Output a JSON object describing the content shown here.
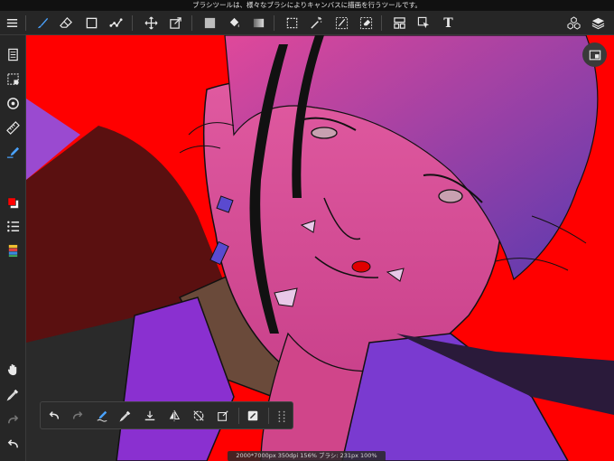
{
  "hint": {
    "text": "ブラシツールは、様々なブラシによりキャンバスに描画を行うツールです。"
  },
  "toolbar": {
    "text_tool_glyph": "T",
    "tools": [
      {
        "name": "menu-icon"
      },
      {
        "name": "brush-tool-icon",
        "active": true
      },
      {
        "name": "eraser-tool-icon"
      },
      {
        "name": "shape-tool-icon"
      },
      {
        "name": "dot-brush-icon"
      },
      {
        "name": "move-tool-icon"
      },
      {
        "name": "transform-tool-icon"
      },
      {
        "name": "fill-color-icon"
      },
      {
        "name": "bucket-tool-icon"
      },
      {
        "name": "gradient-tool-icon"
      },
      {
        "name": "select-tool-icon"
      },
      {
        "name": "magic-wand-icon"
      },
      {
        "name": "select-pen-icon"
      },
      {
        "name": "select-eraser-icon"
      },
      {
        "name": "panel-layout-icon"
      },
      {
        "name": "pointer-tool-icon"
      },
      {
        "name": "text-tool-icon"
      },
      {
        "name": "materials-icon"
      },
      {
        "name": "layers-icon"
      }
    ]
  },
  "sidebar": {
    "items": [
      {
        "name": "pages-icon"
      },
      {
        "name": "selection-icon"
      },
      {
        "name": "snap-icon"
      },
      {
        "name": "ruler-icon"
      },
      {
        "name": "pen-icon"
      },
      {
        "name": "color-swatch-icon"
      },
      {
        "name": "brush-list-icon"
      },
      {
        "name": "color-palette-icon"
      },
      {
        "name": "hand-tool-icon"
      },
      {
        "name": "eyedropper-icon"
      },
      {
        "name": "redo-icon"
      },
      {
        "name": "undo-icon"
      }
    ],
    "primary_color": "#ff0000",
    "secondary_color": "#ffffff"
  },
  "quickbar": {
    "items": [
      {
        "name": "undo-icon"
      },
      {
        "name": "redo-icon"
      },
      {
        "name": "stabilizer-icon"
      },
      {
        "name": "eyedropper-icon"
      },
      {
        "name": "clear-layer-icon"
      },
      {
        "name": "flip-horizontal-icon"
      },
      {
        "name": "rotate-off-icon"
      },
      {
        "name": "transform-icon"
      },
      {
        "name": "layer-toggle-icon"
      },
      {
        "name": "more-icon"
      }
    ]
  },
  "canvas": {
    "background_color": "#ff0000",
    "info": "2000*7000px 350dpi 156% ブラシ: 231px 100%"
  },
  "colors": {
    "ui_bg": "#262626",
    "accent": "#4aa3ff",
    "skin": "#e8508a",
    "hair": "#6a3aa8",
    "cloth": "#8a30d0",
    "collar": "#6a4a3a"
  }
}
